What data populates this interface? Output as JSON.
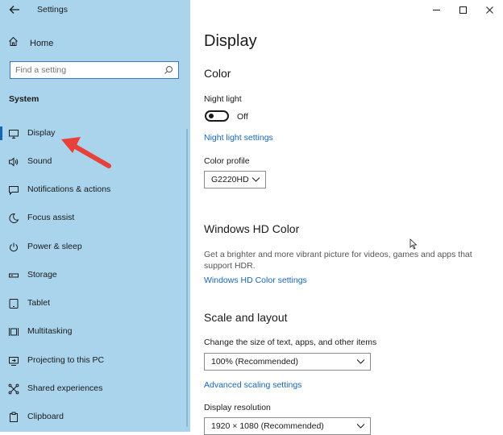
{
  "window": {
    "title": "Settings",
    "controls": {
      "minimize": "—",
      "maximize": "☐",
      "close": "✕"
    }
  },
  "sidebar": {
    "home_label": "Home",
    "search_placeholder": "Find a setting",
    "section_label": "System",
    "items": [
      {
        "label": "Display",
        "icon": "monitor-icon",
        "active": true
      },
      {
        "label": "Sound",
        "icon": "speaker-icon"
      },
      {
        "label": "Notifications & actions",
        "icon": "notification-icon"
      },
      {
        "label": "Focus assist",
        "icon": "moon-icon"
      },
      {
        "label": "Power & sleep",
        "icon": "power-icon"
      },
      {
        "label": "Storage",
        "icon": "storage-icon"
      },
      {
        "label": "Tablet",
        "icon": "tablet-icon"
      },
      {
        "label": "Multitasking",
        "icon": "multitasking-icon"
      },
      {
        "label": "Projecting to this PC",
        "icon": "projector-icon"
      },
      {
        "label": "Shared experiences",
        "icon": "shared-icon"
      },
      {
        "label": "Clipboard",
        "icon": "clipboard-icon"
      }
    ]
  },
  "main": {
    "page_title": "Display",
    "color": {
      "heading": "Color",
      "night_light_label": "Night light",
      "night_light_state": "Off",
      "night_light_link": "Night light settings",
      "color_profile_label": "Color profile",
      "color_profile_value": "G2220HD"
    },
    "hd_color": {
      "heading": "Windows HD Color",
      "description": "Get a brighter and more vibrant picture for videos, games and apps that support HDR.",
      "link": "Windows HD Color settings"
    },
    "scale_layout": {
      "heading": "Scale and layout",
      "scale_label": "Change the size of text, apps, and other items",
      "scale_value": "100% (Recommended)",
      "advanced_link": "Advanced scaling settings",
      "resolution_label": "Display resolution",
      "resolution_value": "1920 × 1080 (Recommended)"
    }
  },
  "colors": {
    "sidebar_bg": "#a9d4ec",
    "accent": "#1766b5",
    "annotation_arrow": "#e8413a"
  }
}
